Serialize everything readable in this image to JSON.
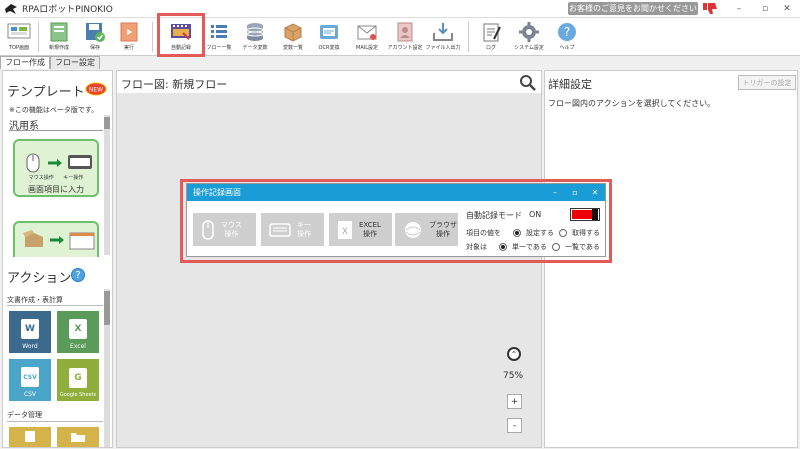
{
  "app": {
    "title": "RPAロボットPINOKIO",
    "feedback_label": "お客様のご意見をお聞かせください",
    "window_controls": {
      "minimize": "–",
      "maximize": "▫",
      "close": "✕"
    }
  },
  "toolbar": {
    "top_label": "TOP画面",
    "new_label": "新規作成",
    "save_label": "保存",
    "run_label": "実行",
    "record_label": "自動記録",
    "flow_list_label": "フロー一覧",
    "data_label": "データ変数",
    "var_list_label": "変数一覧",
    "ocr_label": "OCR変換",
    "mail_label": "MAIL設定",
    "account_label": "アカウント設定",
    "file_io_label": "ファイル入出力",
    "log_label": "ログ",
    "system_label": "システム設定",
    "help_label": "ヘルプ"
  },
  "tabs": {
    "flow_create": "フロー作成",
    "flow_settings": "フロー設定"
  },
  "templates": {
    "title": "テンプレート",
    "new_badge": "NEW",
    "beta_note": "※この機能はベータ版です。",
    "category": "汎用系",
    "card1_mouse_label": "マウス操作",
    "card1_key_label": "キー操作",
    "card1_caption": "画面項目に入力"
  },
  "actions": {
    "title": "アクション",
    "help": "?",
    "cat_docs": "文書作成・表計算",
    "word": "Word",
    "excel": "Excel",
    "csv": "CSV",
    "gsheets": "Google Sheets",
    "cat_data": "データ管理",
    "colors": {
      "word": "#3b6a8c",
      "excel": "#5a9b5a",
      "csv": "#4aa5c8",
      "gsheets": "#8fae3c",
      "folder": "#d4b44a"
    }
  },
  "flow": {
    "title": "フロー図:  新規フロー",
    "zoom_up": "⌃",
    "zoom_level": "75%",
    "zoom_in": "+",
    "zoom_out": "-"
  },
  "detail": {
    "title": "詳細設定",
    "trigger_button": "トリガーの設定",
    "message": "フロー図内のアクションを選択してください。"
  },
  "record_dialog": {
    "title": "操作記録画面",
    "mouse_label_1": "マウス",
    "mouse_label_2": "操作",
    "key_label_1": "キー",
    "key_label_2": "操作",
    "excel_label_1": "EXCEL",
    "excel_label_2": "操作",
    "browser_label_1": "ブラウザ",
    "browser_label_2": "操作",
    "auto_mode_label": "自動記録モード",
    "auto_mode_state": "ON",
    "item_value_label": "項目の値を",
    "set_option": "設定する",
    "get_option": "取得する",
    "target_label": "対象は",
    "single_option": "単一である",
    "list_option": "一覧である",
    "toggle_color": "#e00000"
  }
}
